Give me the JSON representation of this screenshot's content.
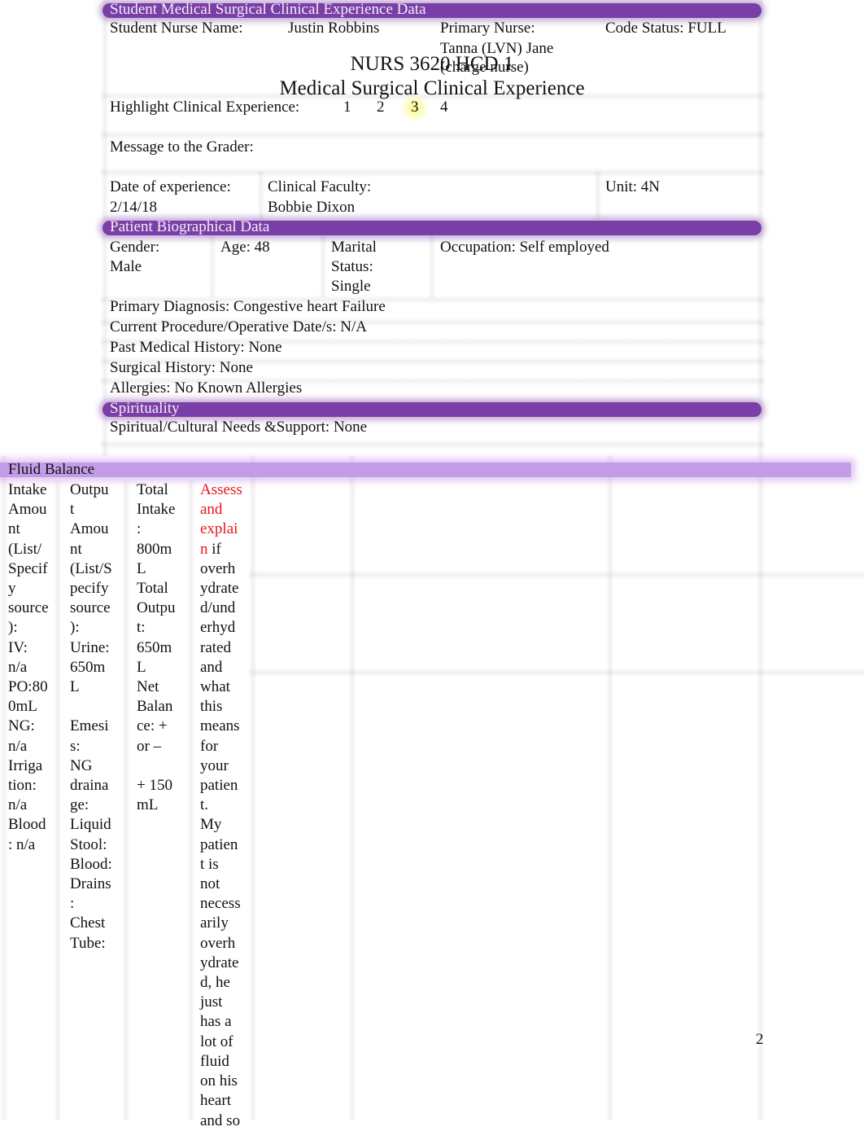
{
  "header": {
    "section_title": "Student Medical Surgical Clinical Experience Data",
    "student_nurse_label": "Student Nurse Name:",
    "student_nurse_value": "Justin Robbins",
    "primary_nurse_label": "Primary Nurse:",
    "primary_nurse_line1": "Tanna (LVN) Jane",
    "primary_nurse_line2": "(charge nurse)",
    "code_status": "Code Status: FULL",
    "course_title": "NURS 3620 HCD 1",
    "course_subtitle": "Medical Surgical Clinical Experience",
    "highlight_label": "Highlight Clinical Experience:",
    "highlight_options": [
      "1",
      "2",
      "3",
      "4"
    ],
    "highlight_selected": "3",
    "highlight_color": "#f7f77a",
    "message_label": "Message to the Grader:",
    "date_label": "Date of experience:",
    "date_value": "2/14/18",
    "faculty_label": "Clinical Faculty:",
    "faculty_value": "Bobbie Dixon",
    "unit": "Unit: 4N"
  },
  "biographical": {
    "section_title": "Patient Biographical Data",
    "gender_label": "Gender:",
    "gender_value": "Male",
    "age": "Age: 48",
    "marital_line1": "Marital",
    "marital_line2": "Status:",
    "marital_value": "Single",
    "occupation": "Occupation: Self employed",
    "primary_diagnosis": "Primary Diagnosis: Congestive heart Failure",
    "current_procedure": "Current Procedure/Operative Date/s: N/A",
    "past_medical_history": "Past Medical History: None",
    "surgical_history": "Surgical History: None",
    "allergies": "Allergies: No Known Allergies"
  },
  "spirituality": {
    "section_title": "Spirituality",
    "needs": "Spiritual/Cultural Needs &Support: None"
  },
  "fluid_balance": {
    "section_title": "Fluid Balance",
    "intake_column": "Intake\nAmou\nnt\n(List/\nSpecif\ny\nsource\n):\nIV:\nn/a\nPO:80\n0mL\nNG:\nn/a\nIrriga\ntion:\nn/a\nBlood\n: n/a",
    "output_column": "Outpu\nt\nAmou\nnt\n(List/S\npecify\nsource\n):\nUrine:\n650m\nL\n\nEmesi\ns:\nNG\ndraina\nge:\nLiquid\nStool:\nBlood:\nDrains\n:\nChest\nTube:",
    "totals_column": "Total\nIntake\n:\n800m\nL\nTotal\nOutpu\nt:\n650m\nL\nNet\nBalan\nce: +\nor –\n\n+ 150\nmL",
    "assess_prompt": "Assess\nand\nexplai\nn",
    "assess_answer": " if\noverh\nydrate\nd/und\nerhyd\nrated\nand\nwhat\nthis\nmeans\nfor\nyour\npatien\nt.\nMy\npatien\nt is\nnot\nnecess\narily\noverh\nydrate\nd, he\njust\nhas a\nlot of\nfluid\non his\nheart\nand so",
    "prompt_color": "#e8141a"
  },
  "footer": {
    "page_number": "2"
  },
  "colors": {
    "section_band": "#7a3fa6",
    "fluid_band": "#c49be8"
  }
}
